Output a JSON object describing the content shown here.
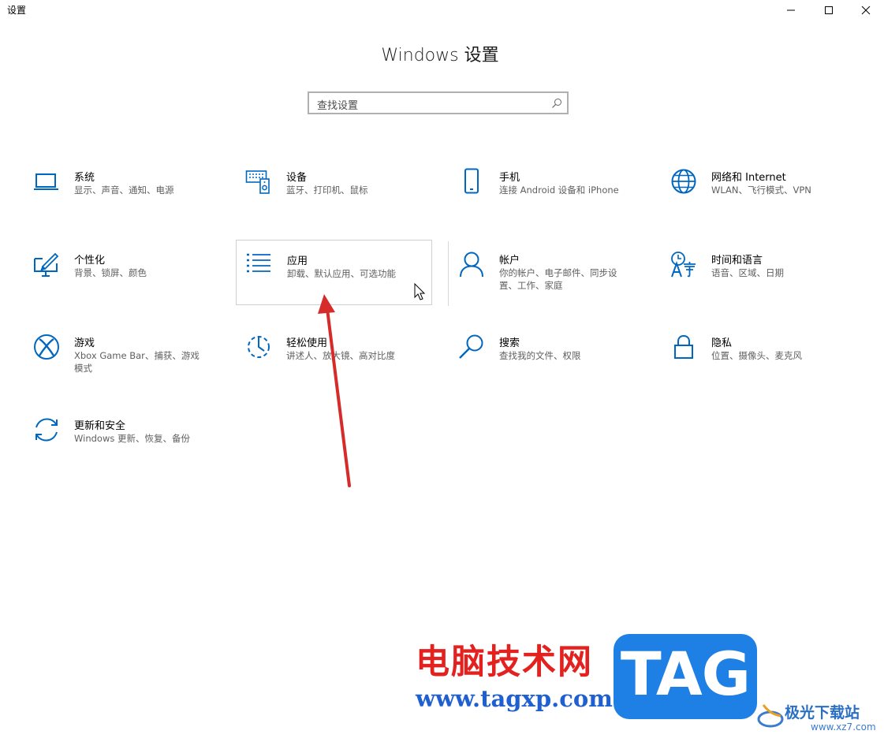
{
  "window": {
    "title": "设置"
  },
  "page": {
    "title": "Windows 设置"
  },
  "search": {
    "placeholder": "查找设置"
  },
  "tiles": [
    {
      "label": "系统",
      "desc": "显示、声音、通知、电源",
      "icon": "laptop-icon"
    },
    {
      "label": "设备",
      "desc": "蓝牙、打印机、鼠标",
      "icon": "devices-icon"
    },
    {
      "label": "手机",
      "desc": "连接 Android 设备和 iPhone",
      "icon": "phone-icon"
    },
    {
      "label": "网络和 Internet",
      "desc": "WLAN、飞行模式、VPN",
      "icon": "globe-icon"
    },
    {
      "label": "个性化",
      "desc": "背景、锁屏、颜色",
      "icon": "personalization-icon"
    },
    {
      "label": "应用",
      "desc": "卸载、默认应用、可选功能",
      "icon": "apps-list-icon"
    },
    {
      "label": "帐户",
      "desc": "你的帐户、电子邮件、同步设置、工作、家庭",
      "icon": "person-icon"
    },
    {
      "label": "时间和语言",
      "desc": "语音、区域、日期",
      "icon": "time-language-icon"
    },
    {
      "label": "游戏",
      "desc": "Xbox Game Bar、捕获、游戏模式",
      "icon": "xbox-icon"
    },
    {
      "label": "轻松使用",
      "desc": "讲述人、放大镜、高对比度",
      "icon": "ease-of-access-icon"
    },
    {
      "label": "搜索",
      "desc": "查找我的文件、权限",
      "icon": "search-magnifier-icon"
    },
    {
      "label": "隐私",
      "desc": "位置、摄像头、麦克风",
      "icon": "lock-icon"
    },
    {
      "label": "更新和安全",
      "desc": "Windows 更新、恢复、备份",
      "icon": "sync-icon"
    }
  ],
  "watermark": {
    "site_name": "电脑技术网",
    "site_url": "www.tagxp.com",
    "tag_logo": "TAG",
    "logo2_name": "极光下载站",
    "logo2_url": "www.xz7.com"
  },
  "colors": {
    "accent": "#0067c0",
    "arrow": "#d62b2b"
  }
}
